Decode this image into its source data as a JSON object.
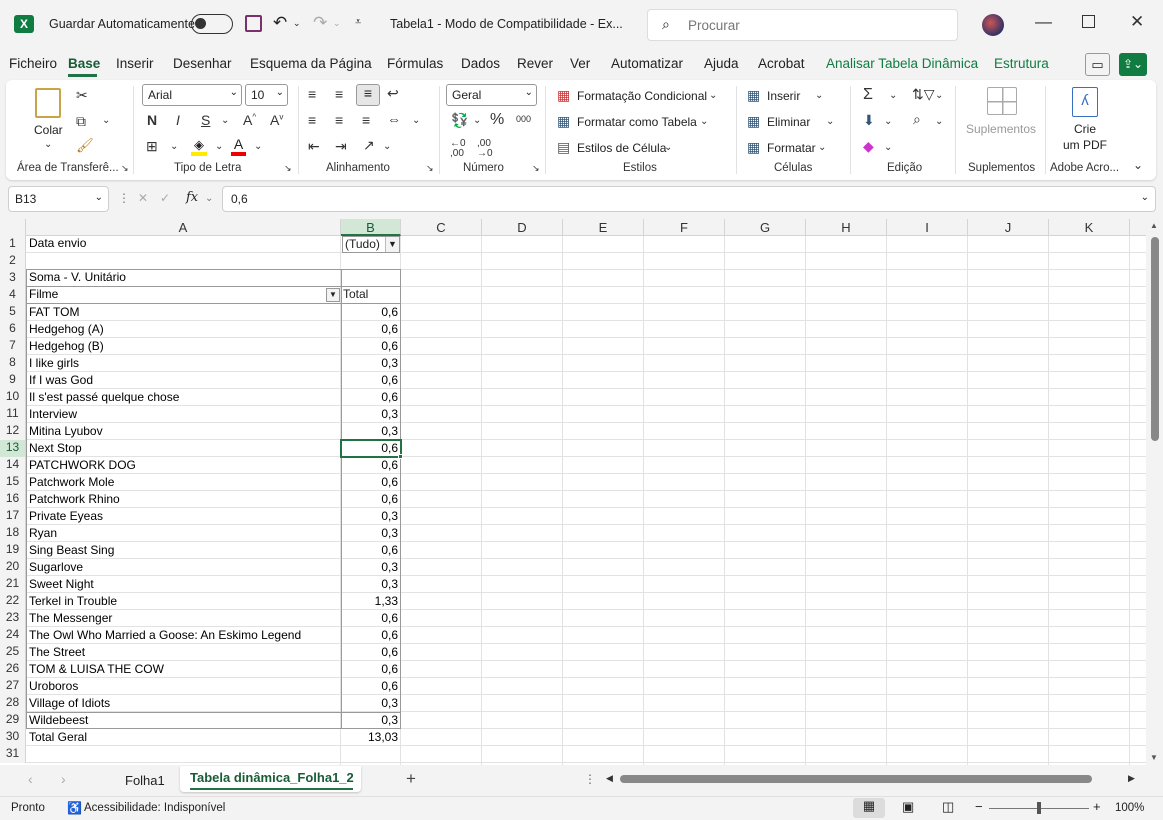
{
  "titlebar": {
    "autosave_label": "Guardar Automaticamente",
    "doc_title": "Tabela1  -  Modo de Compatibilidade  -  Ex...",
    "search_placeholder": "Procurar"
  },
  "menu": [
    "Ficheiro",
    "Base",
    "Inserir",
    "Desenhar",
    "Esquema da Página",
    "Fórmulas",
    "Dados",
    "Rever",
    "Ver",
    "Automatizar",
    "Ajuda",
    "Acrobat",
    "Analisar Tabela Dinâmica",
    "Estrutura"
  ],
  "ribbon": {
    "clipboard": {
      "paste": "Colar",
      "label": "Área de Transferê..."
    },
    "font": {
      "name": "Arial",
      "size": "10",
      "label": "Tipo de Letra"
    },
    "alignment": {
      "label": "Alinhamento"
    },
    "number": {
      "format": "Geral",
      "label": "Número"
    },
    "styles": {
      "cond": "Formatação Condicional",
      "table": "Formatar como Tabela",
      "cell": "Estilos de Célula",
      "label": "Estilos"
    },
    "cells": {
      "insert": "Inserir",
      "delete": "Eliminar",
      "format": "Formatar",
      "label": "Células"
    },
    "editing": {
      "label": "Edição"
    },
    "addins": {
      "btn": "Suplementos",
      "label": "Suplementos"
    },
    "adobe": {
      "btn1": "Crie",
      "btn2": "um PDF",
      "label": "Adobe Acro..."
    }
  },
  "formula_bar": {
    "cell": "B13",
    "fx": "fx",
    "value": "0,6"
  },
  "columns": [
    "A",
    "B",
    "C",
    "D",
    "E",
    "F",
    "G",
    "H",
    "I",
    "J",
    "K"
  ],
  "sheet": {
    "filter_label": "Data envio",
    "filter_value": "(Tudo)",
    "value_header": "Soma - V. Unitário",
    "row_label_header": "Filme",
    "total_header": "Total",
    "rows": [
      {
        "name": "FAT TOM",
        "value": "0,6"
      },
      {
        "name": "Hedgehog (A)",
        "value": "0,6"
      },
      {
        "name": "Hedgehog (B)",
        "value": "0,6"
      },
      {
        "name": "I like girls",
        "value": "0,3"
      },
      {
        "name": "If I was God",
        "value": "0,6"
      },
      {
        "name": "Il s'est passé quelque chose",
        "value": "0,6"
      },
      {
        "name": "Interview",
        "value": "0,3"
      },
      {
        "name": "Mitina Lyubov",
        "value": "0,3"
      },
      {
        "name": "Next Stop",
        "value": "0,6"
      },
      {
        "name": "PATCHWORK DOG",
        "value": "0,6"
      },
      {
        "name": "Patchwork Mole",
        "value": "0,6"
      },
      {
        "name": "Patchwork Rhino",
        "value": "0,6"
      },
      {
        "name": "Private Eyeas",
        "value": "0,3"
      },
      {
        "name": "Ryan",
        "value": "0,3"
      },
      {
        "name": "Sing Beast Sing",
        "value": "0,6"
      },
      {
        "name": "Sugarlove",
        "value": "0,3"
      },
      {
        "name": "Sweet Night",
        "value": "0,3"
      },
      {
        "name": "Terkel in Trouble",
        "value": "1,33"
      },
      {
        "name": "The Messenger",
        "value": "0,6"
      },
      {
        "name": "The Owl Who Married a Goose: An Eskimo Legend",
        "value": "0,6"
      },
      {
        "name": "The Street",
        "value": "0,6"
      },
      {
        "name": "TOM & LUISA THE COW",
        "value": "0,6"
      },
      {
        "name": "Uroboros",
        "value": "0,6"
      },
      {
        "name": "Village of Idiots",
        "value": "0,3"
      },
      {
        "name": "Wildebeest",
        "value": "0,3"
      }
    ],
    "grand_total_label": "Total Geral",
    "grand_total": "13,03"
  },
  "tabs": [
    "Folha1",
    "Tabela dinâmica_Folha1_2"
  ],
  "status": {
    "ready": "Pronto",
    "accessibility": "Acessibilidade: Indisponível",
    "zoom": "100%"
  }
}
